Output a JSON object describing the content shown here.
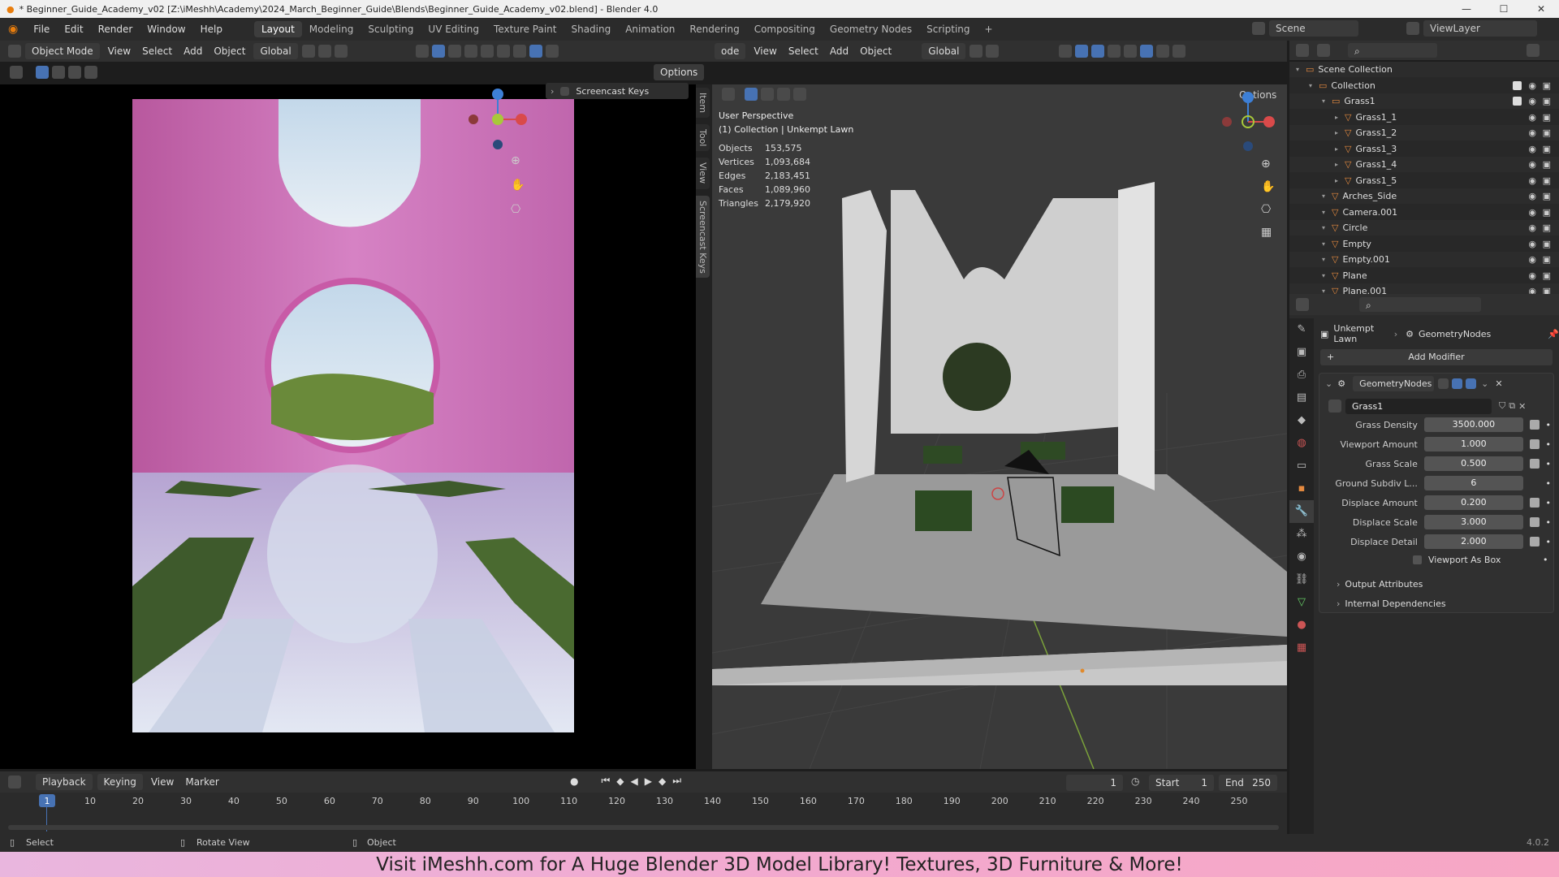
{
  "titlebar": {
    "title": "* Beginner_Guide_Academy_v02 [Z:\\iMeshh\\Academy\\2024_March_Beginner_Guide\\Blends\\Beginner_Guide_Academy_v02.blend] - Blender 4.0"
  },
  "menu": [
    "File",
    "Edit",
    "Render",
    "Window",
    "Help"
  ],
  "workspaces": [
    "Layout",
    "Modeling",
    "Sculpting",
    "UV Editing",
    "Texture Paint",
    "Shading",
    "Animation",
    "Rendering",
    "Compositing",
    "Geometry Nodes",
    "Scripting"
  ],
  "scene": {
    "scene_label": "Scene",
    "viewlayer_label": "ViewLayer"
  },
  "left_header": {
    "mode": "Object Mode",
    "view": "View",
    "select": "Select",
    "add": "Add",
    "object": "Object",
    "orientation": "Global",
    "options": "Options"
  },
  "right_header": {
    "mode": "ode",
    "view": "View",
    "select": "Select",
    "add": "Add",
    "object": "Object",
    "orientation": "Global",
    "options": "Options"
  },
  "screencast": {
    "label": "Screencast Keys"
  },
  "side_tabs": [
    "Item",
    "Tool",
    "View",
    "Screencast Keys"
  ],
  "viewport_info": {
    "perspective": "User Perspective",
    "collection": "(1) Collection | Unkempt Lawn",
    "stats": [
      {
        "label": "Objects",
        "value": "153,575"
      },
      {
        "label": "Vertices",
        "value": "1,093,684"
      },
      {
        "label": "Edges",
        "value": "2,183,451"
      },
      {
        "label": "Faces",
        "value": "1,089,960"
      },
      {
        "label": "Triangles",
        "value": "2,179,920"
      }
    ]
  },
  "outliner": {
    "items": [
      {
        "name": "Scene Collection",
        "indent": 0
      },
      {
        "name": "Collection",
        "indent": 1
      },
      {
        "name": "Grass1",
        "indent": 2
      },
      {
        "name": "Grass1_1",
        "indent": 3
      },
      {
        "name": "Grass1_2",
        "indent": 3
      },
      {
        "name": "Grass1_3",
        "indent": 3
      },
      {
        "name": "Grass1_4",
        "indent": 3
      },
      {
        "name": "Grass1_5",
        "indent": 3
      },
      {
        "name": "Arches_Side",
        "indent": 2
      },
      {
        "name": "Camera.001",
        "indent": 2
      },
      {
        "name": "Circle",
        "indent": 2
      },
      {
        "name": "Empty",
        "indent": 2
      },
      {
        "name": "Empty.001",
        "indent": 2
      },
      {
        "name": "Plane",
        "indent": 2
      },
      {
        "name": "Plane.001",
        "indent": 2
      }
    ]
  },
  "properties": {
    "breadcrumb_object": "Unkempt Lawn",
    "breadcrumb_modifier": "GeometryNodes",
    "add_modifier": "Add Modifier",
    "modifier_name": "GeometryNodes",
    "node_group": "Grass1",
    "fields": [
      {
        "label": "Grass Density",
        "value": "3500.000"
      },
      {
        "label": "Viewport Amount",
        "value": "1.000"
      },
      {
        "label": "Grass Scale",
        "value": "0.500"
      },
      {
        "label": "Ground Subdiv L...",
        "value": "6"
      },
      {
        "label": "Displace Amount",
        "value": "0.200"
      },
      {
        "label": "Displace Scale",
        "value": "3.000"
      },
      {
        "label": "Displace Detail",
        "value": "2.000"
      }
    ],
    "checkbox": "Viewport As Box",
    "panels": [
      "Output Attributes",
      "Internal Dependencies"
    ]
  },
  "timeline": {
    "menus": [
      "Playback",
      "Keying",
      "View",
      "Marker"
    ],
    "current_frame": "1",
    "start_label": "Start",
    "start": "1",
    "end_label": "End",
    "end": "250",
    "frames": [
      "1",
      "10",
      "20",
      "30",
      "40",
      "50",
      "60",
      "70",
      "80",
      "90",
      "100",
      "110",
      "120",
      "130",
      "140",
      "150",
      "160",
      "170",
      "180",
      "190",
      "200",
      "210",
      "220",
      "230",
      "240",
      "250"
    ]
  },
  "statusbar": {
    "select": "Select",
    "rotate": "Rotate View",
    "object": "Object",
    "version": "4.0.2"
  },
  "banner": {
    "text": "Visit iMeshh.com for A Huge Blender 3D Model Library! Textures, 3D Furniture & More!"
  },
  "colors": {
    "accent": "#4772b3",
    "object_orange": "#e58a3f",
    "render_pink": "#d07fc0",
    "banner_pink": "#f2a9cf"
  }
}
